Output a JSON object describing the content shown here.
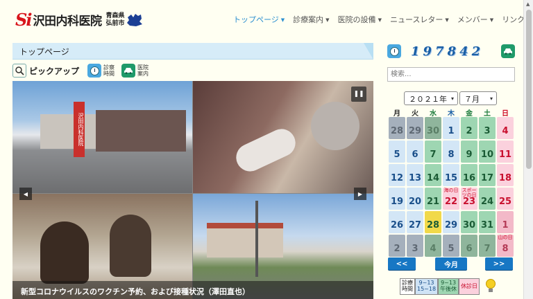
{
  "header": {
    "logo_mark": "Si",
    "logo_text": "沢田内科医院",
    "logo_sub1": "青森県",
    "logo_sub2": "弘前市",
    "nav": [
      {
        "label": "トップページ",
        "caret": "▼"
      },
      {
        "label": "診療案内",
        "caret": "▼"
      },
      {
        "label": "医院の設備",
        "caret": "▼"
      },
      {
        "label": "ニュースレター",
        "caret": "▼"
      },
      {
        "label": "メンバー",
        "caret": "▼"
      },
      {
        "label": "リンク集",
        "caret": ""
      }
    ],
    "accent_color": "#2b8fd0"
  },
  "page_title": "トップページ",
  "pickup": {
    "label": "ピックアップ",
    "hours_label_1": "診察",
    "hours_label_2": "時間",
    "guide_label_1": "医院",
    "guide_label_2": "案内"
  },
  "slideshow": {
    "pause_glyph": "❚❚",
    "prev_glyph": "◀",
    "next_glyph": "▶",
    "sign_text": "沢田内科医院",
    "caption": "新型コロナウイルスのワクチン予約、および接種状況（澤田直也）"
  },
  "sidebar": {
    "counter": "197842",
    "search_placeholder": "検索...",
    "year_select": "２０２１年",
    "month_select": "７月",
    "dropdown_glyph": "▾"
  },
  "calendar": {
    "weekdays": [
      {
        "label": "月",
        "color": "#222"
      },
      {
        "label": "火",
        "color": "#222"
      },
      {
        "label": "水",
        "color": "#1b7a3a"
      },
      {
        "label": "木",
        "color": "#1a5fa6"
      },
      {
        "label": "金",
        "color": "#1b7a3a"
      },
      {
        "label": "土",
        "color": "#1b7a3a"
      },
      {
        "label": "日",
        "color": "#d0102a"
      }
    ],
    "days": [
      {
        "d": "28",
        "bg": "#a5b0bc",
        "fg": "#5e6873",
        "note": ""
      },
      {
        "d": "29",
        "bg": "#a5b0bc",
        "fg": "#5e6873",
        "note": ""
      },
      {
        "d": "30",
        "bg": "#8fb59c",
        "fg": "#5a7e66",
        "note": ""
      },
      {
        "d": "1",
        "bg": "#d3e6f6",
        "fg": "#1a4f8a",
        "note": ""
      },
      {
        "d": "2",
        "bg": "#9ed6b2",
        "fg": "#1b5b35",
        "note": ""
      },
      {
        "d": "3",
        "bg": "#9ed6b2",
        "fg": "#1b5b35",
        "note": ""
      },
      {
        "d": "4",
        "bg": "#fbd1dd",
        "fg": "#c8102e",
        "note": ""
      },
      {
        "d": "5",
        "bg": "#d3e6f6",
        "fg": "#1a4f8a",
        "note": ""
      },
      {
        "d": "6",
        "bg": "#d3e6f6",
        "fg": "#1a4f8a",
        "note": ""
      },
      {
        "d": "7",
        "bg": "#9ed6b2",
        "fg": "#1b5b35",
        "note": ""
      },
      {
        "d": "8",
        "bg": "#d3e6f6",
        "fg": "#1a4f8a",
        "note": ""
      },
      {
        "d": "9",
        "bg": "#9ed6b2",
        "fg": "#1b5b35",
        "note": ""
      },
      {
        "d": "10",
        "bg": "#9ed6b2",
        "fg": "#1b5b35",
        "note": ""
      },
      {
        "d": "11",
        "bg": "#fbd1dd",
        "fg": "#c8102e",
        "note": ""
      },
      {
        "d": "12",
        "bg": "#d3e6f6",
        "fg": "#1a4f8a",
        "note": ""
      },
      {
        "d": "13",
        "bg": "#d3e6f6",
        "fg": "#1a4f8a",
        "note": ""
      },
      {
        "d": "14",
        "bg": "#9ed6b2",
        "fg": "#1b5b35",
        "note": ""
      },
      {
        "d": "15",
        "bg": "#d3e6f6",
        "fg": "#1a4f8a",
        "note": ""
      },
      {
        "d": "16",
        "bg": "#9ed6b2",
        "fg": "#1b5b35",
        "note": ""
      },
      {
        "d": "17",
        "bg": "#9ed6b2",
        "fg": "#1b5b35",
        "note": ""
      },
      {
        "d": "18",
        "bg": "#fbd1dd",
        "fg": "#c8102e",
        "note": ""
      },
      {
        "d": "19",
        "bg": "#d3e6f6",
        "fg": "#1a4f8a",
        "note": ""
      },
      {
        "d": "20",
        "bg": "#d3e6f6",
        "fg": "#1a4f8a",
        "note": ""
      },
      {
        "d": "21",
        "bg": "#9ed6b2",
        "fg": "#1b5b35",
        "note": ""
      },
      {
        "d": "22",
        "bg": "#fbd1dd",
        "fg": "#c8102e",
        "note": "海の日"
      },
      {
        "d": "23",
        "bg": "#fbd1dd",
        "fg": "#c8102e",
        "note": "スポーツの日"
      },
      {
        "d": "24",
        "bg": "#9ed6b2",
        "fg": "#1b5b35",
        "note": ""
      },
      {
        "d": "25",
        "bg": "#fbd1dd",
        "fg": "#c8102e",
        "note": ""
      },
      {
        "d": "26",
        "bg": "#d3e6f6",
        "fg": "#1a4f8a",
        "note": ""
      },
      {
        "d": "27",
        "bg": "#d3e6f6",
        "fg": "#1a4f8a",
        "note": ""
      },
      {
        "d": "28",
        "bg": "#f1d94a",
        "fg": "#1b5b35",
        "note": ""
      },
      {
        "d": "29",
        "bg": "#d3e6f6",
        "fg": "#1a4f8a",
        "note": ""
      },
      {
        "d": "30",
        "bg": "#9ed6b2",
        "fg": "#1b5b35",
        "note": ""
      },
      {
        "d": "31",
        "bg": "#9ed6b2",
        "fg": "#1b5b35",
        "note": ""
      },
      {
        "d": "1",
        "bg": "#f3b9c8",
        "fg": "#b43a56",
        "note": ""
      },
      {
        "d": "2",
        "bg": "#a5b0bc",
        "fg": "#5e6873",
        "note": ""
      },
      {
        "d": "3",
        "bg": "#a5b0bc",
        "fg": "#5e6873",
        "note": ""
      },
      {
        "d": "4",
        "bg": "#8fb59c",
        "fg": "#5a7e66",
        "note": ""
      },
      {
        "d": "5",
        "bg": "#a5b0bc",
        "fg": "#5e6873",
        "note": ""
      },
      {
        "d": "6",
        "bg": "#8fb59c",
        "fg": "#5a7e66",
        "note": ""
      },
      {
        "d": "7",
        "bg": "#8fb59c",
        "fg": "#5a7e66",
        "note": ""
      },
      {
        "d": "8",
        "bg": "#f3b9c8",
        "fg": "#b43a56",
        "note": "山の日"
      }
    ],
    "prev_label": "<<",
    "today_label": "今月",
    "next_label": ">>"
  },
  "legend": {
    "a1": "診療",
    "a2": "時間",
    "b1": "9~13",
    "b2": "15~18",
    "c1": "9~13",
    "c2": "午後休",
    "d": "休診日"
  }
}
